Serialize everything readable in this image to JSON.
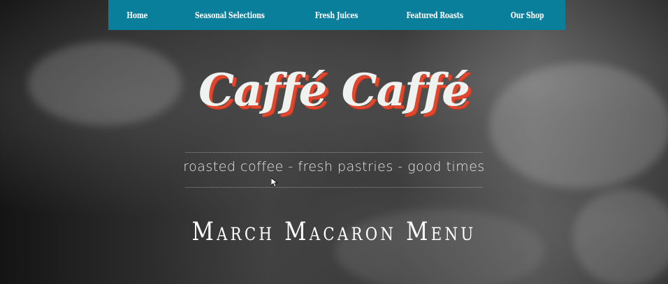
{
  "nav": {
    "items": [
      {
        "label": "Home"
      },
      {
        "label": "Seasonal Selections"
      },
      {
        "label": "Fresh Juices"
      },
      {
        "label": "Featured Roasts"
      },
      {
        "label": "Our Shop"
      }
    ],
    "background": "#0a7f9b"
  },
  "hero": {
    "title": "Caffé Caffé",
    "tagline": "roasted coffee - fresh pastries - good times",
    "title_color": "#eef3ef",
    "title_shadow_color": "#e0472f"
  },
  "menu": {
    "heading": "March Macaron Menu"
  }
}
